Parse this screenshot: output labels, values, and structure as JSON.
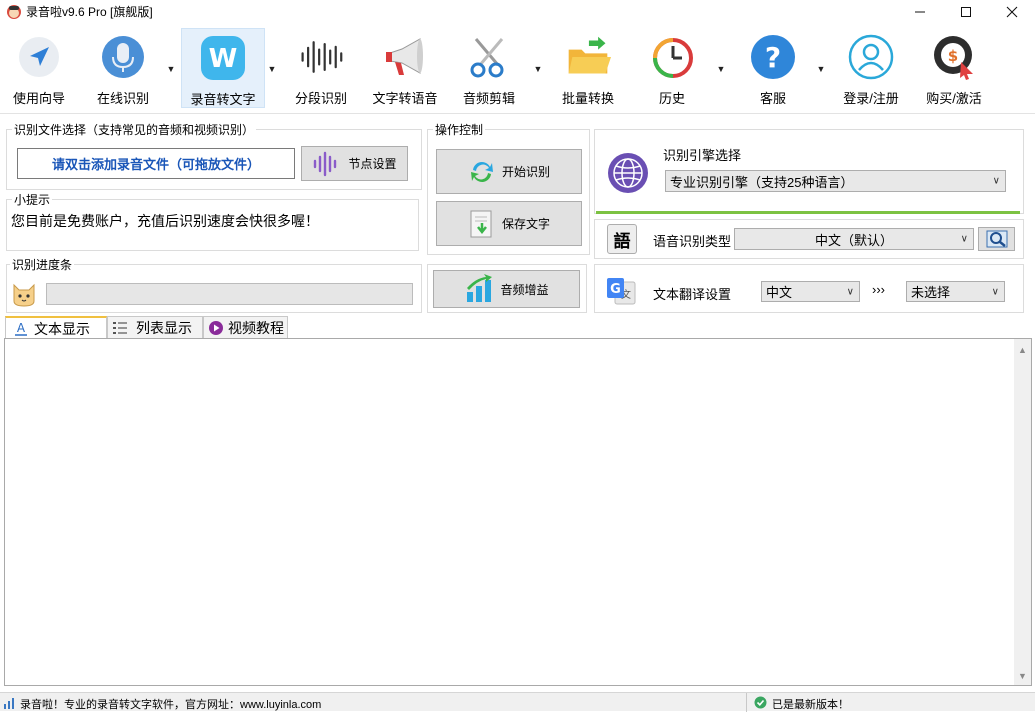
{
  "window": {
    "title": "录音啦v9.6 Pro [旗舰版]"
  },
  "toolbar": {
    "items": [
      {
        "label": "使用向导",
        "icon": "navigation-arrow-icon"
      },
      {
        "label": "在线识别",
        "icon": "microphone-icon"
      },
      {
        "label": "录音转文字",
        "icon": "w-app-icon"
      },
      {
        "label": "分段识别",
        "icon": "soundwave-icon"
      },
      {
        "label": "文字转语音",
        "icon": "megaphone-icon"
      },
      {
        "label": "音频剪辑",
        "icon": "scissors-icon"
      },
      {
        "label": "批量转换",
        "icon": "folder-icon"
      },
      {
        "label": "历史",
        "icon": "history-clock-icon"
      },
      {
        "label": "客服",
        "icon": "help-question-icon"
      },
      {
        "label": "登录/注册",
        "icon": "user-icon"
      },
      {
        "label": "购买/激活",
        "icon": "purchase-coin-icon"
      }
    ],
    "selected": "录音转文字"
  },
  "file_select": {
    "group_label": "识别文件选择（支持常见的音频和视频识别）",
    "add_file_label": "请双击添加录音文件（可拖放文件）",
    "node_settings_label": "节点设置"
  },
  "tips": {
    "group_label": "小提示",
    "text": "您目前是免费账户，充值后识别速度会快很多喔！"
  },
  "progress": {
    "group_label": "识别进度条",
    "value": 0
  },
  "controls": {
    "group_label": "操作控制",
    "start_label": "开始识别",
    "save_label": "保存文字",
    "enhance_label": "音频增益"
  },
  "engine": {
    "label": "识别引擎选择",
    "selected": "专业识别引擎（支持25种语言）"
  },
  "recog_type": {
    "label": "语音识别类型",
    "icon_char": "語",
    "selected": "中文（默认）"
  },
  "translate": {
    "label": "文本翻译设置",
    "from": "中文",
    "arrows": "›››",
    "to": "未选择"
  },
  "tabs": [
    {
      "label": "文本显示",
      "active": true
    },
    {
      "label": "列表显示",
      "active": false
    },
    {
      "label": "视频教程",
      "active": false
    }
  ],
  "statusbar": {
    "left": "录音啦！专业的录音转文字软件，官方网址：www.luyinla.com",
    "right": "已是最新版本！"
  },
  "colors": {
    "accent": "#3b8fd9",
    "progress_green": "#7cc242",
    "selected_tab_border": "#f0c040"
  }
}
